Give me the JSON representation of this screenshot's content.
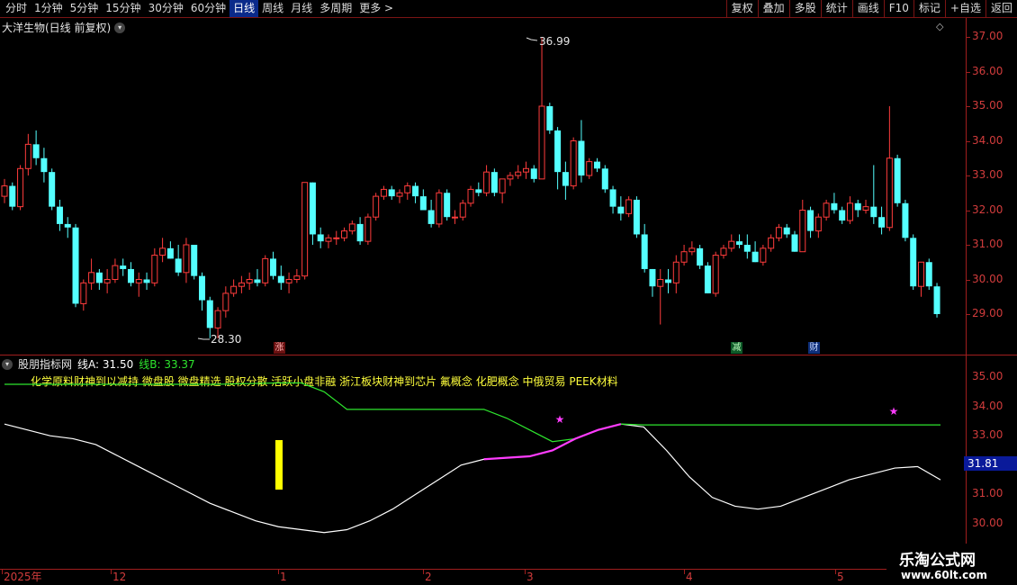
{
  "toolbar": {
    "periods": [
      {
        "label": "分时",
        "active": false
      },
      {
        "label": "1分钟",
        "active": false
      },
      {
        "label": "5分钟",
        "active": false
      },
      {
        "label": "15分钟",
        "active": false
      },
      {
        "label": "30分钟",
        "active": false
      },
      {
        "label": "60分钟",
        "active": false
      },
      {
        "label": "日线",
        "active": true
      },
      {
        "label": "周线",
        "active": false
      },
      {
        "label": "月线",
        "active": false
      },
      {
        "label": "多周期",
        "active": false
      },
      {
        "label": "更多 >",
        "active": false
      }
    ],
    "tools": [
      "复权",
      "叠加",
      "多股",
      "统计",
      "画线",
      "F10",
      "标记",
      "+自选",
      "返回"
    ]
  },
  "main_chart": {
    "title": "大洋生物(日线 前复权)",
    "max_label": "36.99",
    "min_label": "28.30",
    "y_ticks": [
      "37.00",
      "36.00",
      "35.00",
      "34.00",
      "33.00",
      "32.00",
      "31.00",
      "30.00",
      "29.00"
    ],
    "event_markers": [
      "涨",
      "减",
      "财"
    ]
  },
  "indicator": {
    "name": "股朋指标网",
    "lineA": "线A: 31.50",
    "lineB": "线B: 33.37",
    "concepts": "化学原料财神到以减持 微盘股 微盘精选 股权分散 活跃小盘非融 浙江板块财神到芯片 氟概念 化肥概念 中俄贸易 PEEK材料",
    "y_ticks": [
      "35.00",
      "34.00",
      "33.00",
      "31.00",
      "30.00"
    ],
    "cursor_value": "31.81"
  },
  "date_axis": [
    "2025年",
    "12",
    "1",
    "2",
    "3",
    "4",
    "5"
  ],
  "watermark": {
    "title": "乐淘公式网",
    "url": "www.60lt.com"
  },
  "colors": {
    "up": "#ff3c3c",
    "down": "#54ffff",
    "lineA": "#ffffff",
    "lineB": "#2ee62e",
    "highlight": "#ff3cff",
    "bar": "#ffff00",
    "axis": "#a01e1e"
  },
  "chart_data": [
    {
      "type": "candlestick",
      "title": "大洋生物(日线 前复权)",
      "ylim": [
        28.3,
        37.3
      ],
      "candles": [
        [
          32.4,
          32.9,
          32.2,
          32.7
        ],
        [
          32.7,
          32.8,
          32.0,
          32.1
        ],
        [
          32.1,
          33.3,
          32.0,
          33.2
        ],
        [
          33.2,
          34.2,
          33.0,
          33.9
        ],
        [
          33.9,
          34.3,
          33.3,
          33.5
        ],
        [
          33.5,
          33.8,
          32.8,
          33.1
        ],
        [
          33.1,
          33.2,
          32.0,
          32.1
        ],
        [
          32.1,
          32.3,
          31.4,
          31.6
        ],
        [
          31.6,
          31.8,
          31.2,
          31.5
        ],
        [
          31.5,
          31.6,
          29.2,
          29.3
        ],
        [
          29.3,
          30.0,
          29.1,
          29.9
        ],
        [
          29.9,
          30.6,
          29.7,
          30.2
        ],
        [
          30.2,
          30.3,
          29.7,
          29.9
        ],
        [
          29.9,
          30.3,
          29.6,
          30.0
        ],
        [
          30.0,
          30.6,
          29.9,
          30.4
        ],
        [
          30.4,
          30.6,
          30.1,
          30.3
        ],
        [
          30.3,
          30.5,
          29.8,
          29.9
        ],
        [
          29.9,
          30.2,
          29.5,
          30.0
        ],
        [
          30.0,
          30.2,
          29.7,
          29.9
        ],
        [
          29.9,
          30.9,
          29.8,
          30.7
        ],
        [
          30.7,
          31.2,
          30.5,
          30.9
        ],
        [
          30.9,
          31.1,
          30.6,
          30.6
        ],
        [
          30.6,
          31.0,
          30.1,
          30.2
        ],
        [
          30.2,
          31.2,
          29.9,
          31.0
        ],
        [
          31.0,
          31.0,
          30.0,
          30.1
        ],
        [
          30.1,
          30.2,
          29.1,
          29.4
        ],
        [
          29.4,
          29.5,
          28.3,
          28.6
        ],
        [
          28.6,
          29.2,
          28.3,
          29.1
        ],
        [
          29.1,
          29.8,
          28.9,
          29.6
        ],
        [
          29.6,
          30.0,
          29.5,
          29.8
        ],
        [
          29.8,
          30.1,
          29.6,
          29.9
        ],
        [
          29.9,
          30.2,
          29.7,
          30.0
        ],
        [
          30.0,
          30.3,
          29.8,
          29.9
        ],
        [
          29.9,
          30.7,
          29.8,
          30.6
        ],
        [
          30.6,
          30.8,
          30.0,
          30.1
        ],
        [
          30.1,
          30.4,
          29.7,
          29.9
        ],
        [
          29.9,
          30.2,
          29.6,
          30.0
        ],
        [
          30.0,
          30.3,
          29.9,
          30.1
        ],
        [
          30.1,
          32.8,
          30.0,
          32.8
        ],
        [
          32.8,
          32.8,
          31.0,
          31.3
        ],
        [
          31.3,
          31.5,
          30.9,
          31.1
        ],
        [
          31.1,
          31.3,
          30.9,
          31.2
        ],
        [
          31.2,
          31.4,
          31.0,
          31.2
        ],
        [
          31.2,
          31.5,
          31.1,
          31.4
        ],
        [
          31.4,
          31.7,
          31.3,
          31.6
        ],
        [
          31.6,
          31.8,
          31.0,
          31.1
        ],
        [
          31.1,
          31.9,
          31.0,
          31.8
        ],
        [
          31.8,
          32.5,
          31.7,
          32.4
        ],
        [
          32.4,
          32.7,
          32.3,
          32.6
        ],
        [
          32.6,
          32.7,
          32.3,
          32.4
        ],
        [
          32.4,
          32.6,
          32.2,
          32.5
        ],
        [
          32.5,
          32.8,
          32.3,
          32.7
        ],
        [
          32.7,
          32.8,
          32.2,
          32.4
        ],
        [
          32.4,
          32.6,
          32.0,
          32.0
        ],
        [
          32.0,
          32.3,
          31.5,
          31.6
        ],
        [
          31.6,
          32.6,
          31.5,
          32.5
        ],
        [
          32.5,
          32.6,
          31.7,
          31.8
        ],
        [
          31.8,
          32.0,
          31.6,
          31.8
        ],
        [
          31.8,
          32.3,
          31.7,
          32.2
        ],
        [
          32.2,
          32.7,
          32.1,
          32.6
        ],
        [
          32.6,
          32.8,
          32.4,
          32.5
        ],
        [
          32.5,
          33.3,
          32.4,
          33.1
        ],
        [
          33.1,
          33.2,
          32.4,
          32.5
        ],
        [
          32.5,
          32.9,
          32.2,
          32.9
        ],
        [
          32.9,
          33.1,
          32.7,
          33.0
        ],
        [
          33.0,
          33.3,
          32.9,
          33.1
        ],
        [
          33.1,
          33.4,
          32.9,
          33.2
        ],
        [
          33.2,
          33.3,
          32.8,
          32.9
        ],
        [
          32.9,
          37.0,
          32.9,
          35.0
        ],
        [
          35.0,
          35.1,
          34.2,
          34.3
        ],
        [
          34.3,
          34.4,
          32.6,
          33.1
        ],
        [
          33.1,
          33.4,
          32.3,
          32.7
        ],
        [
          32.7,
          34.1,
          32.6,
          34.0
        ],
        [
          34.0,
          34.6,
          32.8,
          33.0
        ],
        [
          33.0,
          33.5,
          32.9,
          33.4
        ],
        [
          33.4,
          33.5,
          33.1,
          33.2
        ],
        [
          33.2,
          33.3,
          32.5,
          32.6
        ],
        [
          32.6,
          32.7,
          31.9,
          32.1
        ],
        [
          32.1,
          32.4,
          31.7,
          31.9
        ],
        [
          31.9,
          32.4,
          31.8,
          32.3
        ],
        [
          32.3,
          32.4,
          31.2,
          31.3
        ],
        [
          31.3,
          31.6,
          30.2,
          30.3
        ],
        [
          30.3,
          30.3,
          29.5,
          29.8
        ],
        [
          29.8,
          30.3,
          28.7,
          30.0
        ],
        [
          30.0,
          30.3,
          29.6,
          29.9
        ],
        [
          29.9,
          30.7,
          29.6,
          30.5
        ],
        [
          30.5,
          31.0,
          30.4,
          30.8
        ],
        [
          30.8,
          31.1,
          30.7,
          30.9
        ],
        [
          30.9,
          31.0,
          30.3,
          30.4
        ],
        [
          30.4,
          30.5,
          29.6,
          29.6
        ],
        [
          29.6,
          30.8,
          29.5,
          30.7
        ],
        [
          30.7,
          31.0,
          30.6,
          30.9
        ],
        [
          30.9,
          31.3,
          30.8,
          31.1
        ],
        [
          31.1,
          31.3,
          30.9,
          31.0
        ],
        [
          31.0,
          31.3,
          30.6,
          30.8
        ],
        [
          30.8,
          31.1,
          30.5,
          30.5
        ],
        [
          30.5,
          31.0,
          30.4,
          30.9
        ],
        [
          30.9,
          31.3,
          30.8,
          31.2
        ],
        [
          31.2,
          31.6,
          31.1,
          31.5
        ],
        [
          31.5,
          31.6,
          31.2,
          31.3
        ],
        [
          31.3,
          31.4,
          30.8,
          30.8
        ],
        [
          30.8,
          32.3,
          30.8,
          32.0
        ],
        [
          32.0,
          32.1,
          31.2,
          31.4
        ],
        [
          31.4,
          31.9,
          31.2,
          31.8
        ],
        [
          31.8,
          32.3,
          31.7,
          32.2
        ],
        [
          32.2,
          32.5,
          31.9,
          32.0
        ],
        [
          32.0,
          32.1,
          31.6,
          31.7
        ],
        [
          31.7,
          32.4,
          31.6,
          32.2
        ],
        [
          32.2,
          32.3,
          31.8,
          32.0
        ],
        [
          32.0,
          32.3,
          31.9,
          32.1
        ],
        [
          32.1,
          33.3,
          31.6,
          31.8
        ],
        [
          31.8,
          32.1,
          31.3,
          31.5
        ],
        [
          31.5,
          35.0,
          31.4,
          33.5
        ],
        [
          33.5,
          33.6,
          32.1,
          32.2
        ],
        [
          32.2,
          32.3,
          31.1,
          31.2
        ],
        [
          31.2,
          31.3,
          29.7,
          29.8
        ],
        [
          29.8,
          30.5,
          29.5,
          30.5
        ],
        [
          30.5,
          30.6,
          29.7,
          29.8
        ],
        [
          29.8,
          29.9,
          28.9,
          29.0
        ]
      ]
    },
    {
      "type": "line",
      "title": "股朋指标网",
      "ylim": [
        29.5,
        35.5
      ],
      "series": [
        {
          "name": "线A",
          "values": [
            33.4,
            33.2,
            33.0,
            32.9,
            32.7,
            32.3,
            31.9,
            31.5,
            31.1,
            30.7,
            30.4,
            30.1,
            29.9,
            29.8,
            29.7,
            29.8,
            30.1,
            30.5,
            31.0,
            31.5,
            32.0,
            32.2,
            32.25,
            32.3,
            32.5,
            32.9,
            33.2,
            33.4,
            33.3,
            32.5,
            31.6,
            30.9,
            30.6,
            30.5,
            30.6,
            30.9,
            31.2,
            31.5,
            31.7,
            31.9,
            31.95,
            31.5
          ]
        },
        {
          "name": "线B",
          "values": [
            null,
            null,
            null,
            null,
            null,
            null,
            null,
            null,
            null,
            null,
            null,
            null,
            34.8,
            34.8,
            34.5,
            33.9,
            33.9,
            33.9,
            33.9,
            33.9,
            33.9,
            33.9,
            33.6,
            33.2,
            32.8,
            32.9,
            33.2,
            33.4,
            33.37,
            33.37,
            33.37,
            33.37,
            33.37,
            33.37,
            33.37,
            33.37,
            33.37,
            33.37,
            33.37,
            33.37,
            33.37,
            33.37
          ]
        }
      ]
    }
  ]
}
